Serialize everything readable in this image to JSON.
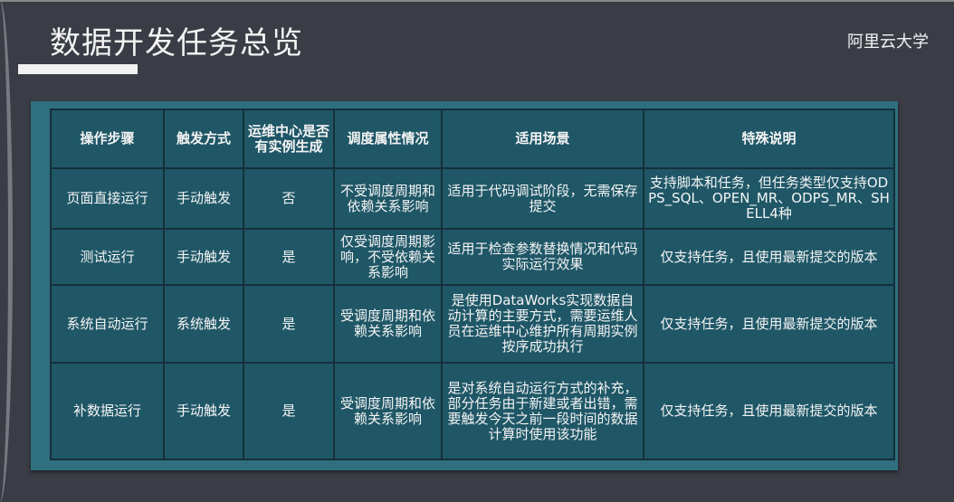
{
  "header": {
    "title": "数据开发任务总览",
    "brand": "阿里云大学"
  },
  "table": {
    "columns": [
      "操作步骤",
      "触发方式",
      "运维中心是否有实例生成",
      "调度属性情况",
      "适用场景",
      "特殊说明"
    ],
    "rows": [
      [
        "页面直接运行",
        "手动触发",
        "否",
        "不受调度周期和依赖关系影响",
        "适用于代码调试阶段，无需保存提交",
        "支持脚本和任务，但任务类型仅支持ODPS_SQL、OPEN_MR、ODPS_MR、SHELL4种"
      ],
      [
        "测试运行",
        "手动触发",
        "是",
        "仅受调度周期影响，不受依赖关系影响",
        "适用于检查参数替换情况和代码实际运行效果",
        "仅支持任务，且使用最新提交的版本"
      ],
      [
        "系统自动运行",
        "系统触发",
        "是",
        "受调度周期和依赖关系影响",
        "是使用DataWorks实现数据自动计算的主要方式，需要运维人员在运维中心维护所有周期实例按序成功执行",
        "仅支持任务，且使用最新提交的版本"
      ],
      [
        "补数据运行",
        "手动触发",
        "是",
        "受调度周期和依赖关系影响",
        "是对系统自动运行方式的补充，部分任务由于新建或者出错，需要触发今天之前一段时间的数据计算时使用该功能",
        "仅支持任务，且使用最新提交的版本"
      ]
    ]
  }
}
